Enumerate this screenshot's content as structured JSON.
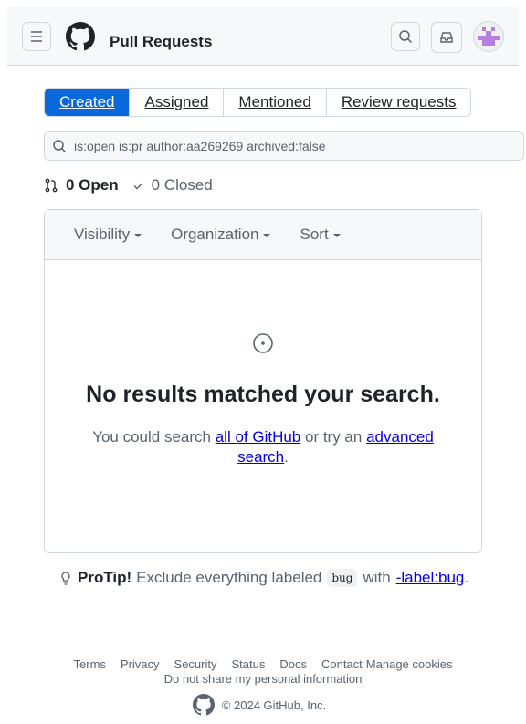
{
  "header": {
    "title": "Pull Requests",
    "menu_icon": "hamburger-icon",
    "logo": "github-mark",
    "search_icon": "search-icon",
    "inbox_icon": "inbox-icon",
    "avatar_color": "#b57fe0"
  },
  "tabs": [
    {
      "label": "Created",
      "selected": true
    },
    {
      "label": "Assigned"
    },
    {
      "label": "Mentioned"
    },
    {
      "label": "Review requests"
    }
  ],
  "search": {
    "value": "is:open is:pr author:aa269269 archived:false"
  },
  "states": {
    "open": "0 Open",
    "closed": "0 Closed"
  },
  "filters": [
    "Visibility",
    "Organization",
    "Sort"
  ],
  "blankslate": {
    "heading": "No results matched your search.",
    "text_before": "You could search ",
    "link1": "all of GitHub",
    "text_middle": " or try an ",
    "link2": "advanced search",
    "text_after": "."
  },
  "protip": {
    "label": "ProTip!",
    "text": "Exclude everything labeled",
    "code": "bug",
    "with": "with",
    "link": "-label:bug",
    "end": "."
  },
  "footer": {
    "links": [
      "Terms",
      "Privacy",
      "Security",
      "Status",
      "Docs",
      "Contact",
      "Manage cookies"
    ],
    "privacy": "Do not share my personal information",
    "copyright": "© 2024 GitHub, Inc."
  },
  "colors": {
    "accent": "#0969da",
    "link": "#0000ee"
  }
}
